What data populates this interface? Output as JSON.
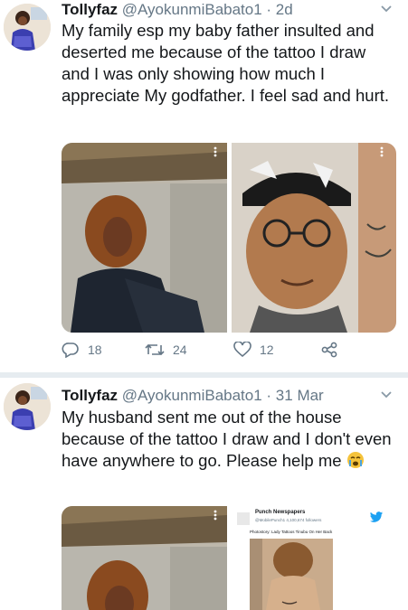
{
  "tweets": [
    {
      "display_name": "Tollyfaz",
      "handle": "@AyokunmiBabato1",
      "time": " · 2d",
      "text": "My family esp my baby father insulted and deserted me because of the tattoo I draw and I was only showing how much I appreciate My godfather. I feel sad and hurt.",
      "replies": "18",
      "retweets": "24",
      "likes": "12",
      "icons": [
        "reply-icon",
        "retweet-icon",
        "like-icon",
        "share-icon"
      ]
    },
    {
      "display_name": "Tollyfaz",
      "handle": "@AyokunmiBabato1",
      "time": " · 31 Mar",
      "text": "My husband sent me out of the house because of the tattoo I draw and I don't even have anywhere to go. Please help me",
      "emoji": "crying-face-emoji",
      "embedded_post": {
        "account_name": "Punch Newspapers",
        "account_meta": "@MobilePunch1 4,100,674 followers",
        "caption": "Photostory: Lady Tattoos Tinubu On Her Back"
      }
    }
  ],
  "colors": {
    "text": "#14171a",
    "secondary": "#657786",
    "twitter_blue": "#1da1f2",
    "divider": "#e6ecf0"
  }
}
